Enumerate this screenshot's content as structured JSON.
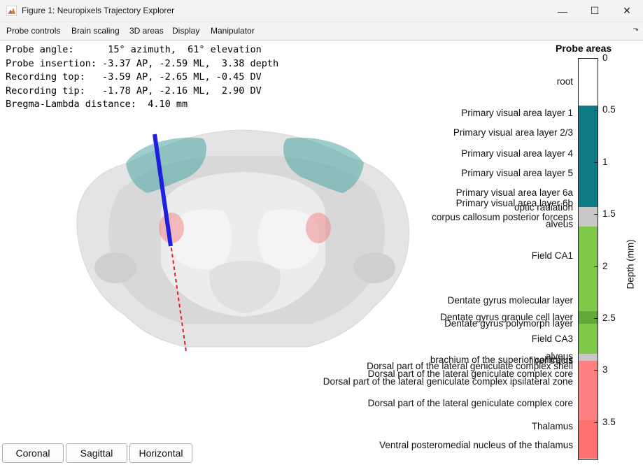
{
  "window": {
    "title": "Figure 1: Neuropixels Trajectory Explorer",
    "minimize_glyph": "—",
    "maximize_glyph": "☐",
    "close_glyph": "✕"
  },
  "menu": {
    "items": [
      "Probe controls",
      "Brain scaling",
      "3D areas",
      "Display",
      "Manipulator"
    ],
    "overflow_glyph": "⬎"
  },
  "info": {
    "lines": [
      "Probe angle:      15° azimuth,  61° elevation",
      "Probe insertion: -3.37 AP, -2.59 ML,  3.38 depth",
      "Recording top:   -3.59 AP, -2.65 ML, -0.45 DV",
      "Recording tip:   -1.78 AP, -2.16 ML,  2.90 DV",
      "Bregma-Lambda distance:  4.10 mm"
    ]
  },
  "colorbar": {
    "title": "Probe areas",
    "ylabel": "Depth (mm)",
    "ticks": [
      "0",
      "0.5",
      "1",
      "1.5",
      "2",
      "2.5",
      "3",
      "3.5"
    ],
    "segments": [
      {
        "from": 0.0,
        "to": 0.46,
        "color": "#ffffff"
      },
      {
        "from": 0.46,
        "to": 1.43,
        "color": "#0e7b85"
      },
      {
        "from": 1.43,
        "to": 1.62,
        "color": "#c8c8c8"
      },
      {
        "from": 1.62,
        "to": 2.43,
        "color": "#7fc84a"
      },
      {
        "from": 2.43,
        "to": 2.55,
        "color": "#62a83a"
      },
      {
        "from": 2.55,
        "to": 2.84,
        "color": "#7fc84a"
      },
      {
        "from": 2.84,
        "to": 2.91,
        "color": "#c8c8c8"
      },
      {
        "from": 2.91,
        "to": 3.48,
        "color": "#ff8080"
      },
      {
        "from": 3.48,
        "to": 3.85,
        "color": "#ff7070"
      }
    ],
    "labels": [
      {
        "text": "root",
        "depth": 0.23
      },
      {
        "text": "Primary visual area layer 1",
        "depth": 0.53
      },
      {
        "text": "Primary visual area layer 2/3",
        "depth": 0.72
      },
      {
        "text": "Primary visual area layer 4",
        "depth": 0.92
      },
      {
        "text": "Primary visual area layer 5",
        "depth": 1.11
      },
      {
        "text": "Primary visual area layer 6a",
        "depth": 1.3
      },
      {
        "text": "Primary visual area layer 6b",
        "depth": 1.4
      },
      {
        "text": "optic radiation",
        "depth": 1.44
      },
      {
        "text": "corpus callosum posterior forceps",
        "depth": 1.53
      },
      {
        "text": "alveus",
        "depth": 1.6
      },
      {
        "text": "Field CA1",
        "depth": 1.9
      },
      {
        "text": "Dentate gyrus molecular layer",
        "depth": 2.33
      },
      {
        "text": "Dentate gyrus granule cell layer",
        "depth": 2.49
      },
      {
        "text": "Dentate gyrus polymorph layer",
        "depth": 2.55
      },
      {
        "text": "Field CA3",
        "depth": 2.7
      },
      {
        "text": "alveus",
        "depth": 2.87
      },
      {
        "text": "brachium of the superior colliculus",
        "depth": 2.9
      },
      {
        "text": "fiber tracts",
        "depth": 2.91
      },
      {
        "text": "Dorsal part of the lateral geniculate complex shell",
        "depth": 2.96
      },
      {
        "text": "Dorsal part of the lateral geniculate complex core",
        "depth": 3.04
      },
      {
        "text": "Dorsal part of the lateral geniculate complex ipsilateral zone",
        "depth": 3.11
      },
      {
        "text": "Dorsal part of the lateral geniculate complex core",
        "depth": 3.32
      },
      {
        "text": "Thalamus",
        "depth": 3.54
      },
      {
        "text": "Ventral posteromedial nucleus of the thalamus",
        "depth": 3.72
      }
    ]
  },
  "view_buttons": [
    "Coronal",
    "Sagittal",
    "Horizontal"
  ],
  "colors": {
    "probe_recording": "#1f1fe0",
    "probe_trajectory": "#e02020",
    "visual_cortex": "#4aa6a6",
    "lgn": "#f07f7f",
    "brain": "#c8c8c8"
  }
}
